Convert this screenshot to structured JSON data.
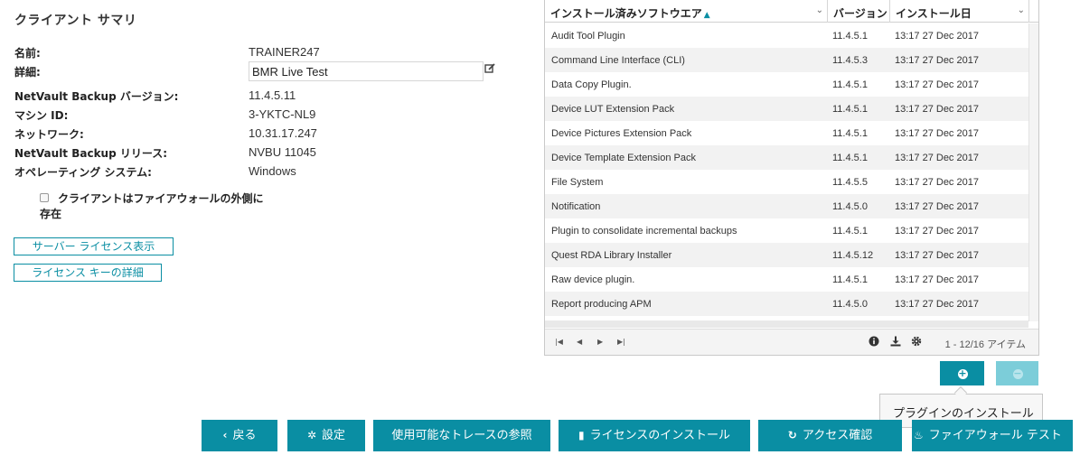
{
  "summary": {
    "title": "クライアント サマリ",
    "fields": [
      {
        "label": "名前:",
        "value": "TRAINER247"
      },
      {
        "label": "詳細:",
        "value": "BMR Live Test"
      },
      {
        "label": "NetVault Backup バージョン:",
        "value": "11.4.5.11"
      },
      {
        "label": "マシン ID:",
        "value": "3-YKTC-NL9"
      },
      {
        "label": "ネットワーク:",
        "value": "10.31.17.247"
      },
      {
        "label": "NetVault Backup リリース:",
        "value": "NVBU 11045"
      },
      {
        "label": "オペレーティング システム:",
        "value": "Windows"
      }
    ],
    "firewall_label": "クライアントはファイアウォールの外側に存在",
    "firewall_checked": false,
    "buttons": {
      "server_license": "サーバー ライセンス表示",
      "license_key": "ライセンス キーの詳細"
    }
  },
  "software_grid": {
    "columns": [
      "インストール済みソフトウエア",
      "バージョン",
      "インストール日"
    ],
    "sort_column": "インストール済みソフトウエア",
    "sort_direction": "ascending",
    "rows": [
      {
        "name": "Audit Tool Plugin",
        "version": "11.4.5.1",
        "date": "13:17 27 Dec 2017"
      },
      {
        "name": "Command Line Interface (CLI)",
        "version": "11.4.5.3",
        "date": "13:17 27 Dec 2017"
      },
      {
        "name": "Data Copy Plugin.",
        "version": "11.4.5.1",
        "date": "13:17 27 Dec 2017"
      },
      {
        "name": "Device LUT Extension Pack",
        "version": "11.4.5.1",
        "date": "13:17 27 Dec 2017"
      },
      {
        "name": "Device Pictures Extension Pack",
        "version": "11.4.5.1",
        "date": "13:17 27 Dec 2017"
      },
      {
        "name": "Device Template Extension Pack",
        "version": "11.4.5.1",
        "date": "13:17 27 Dec 2017"
      },
      {
        "name": "File System",
        "version": "11.4.5.5",
        "date": "13:17 27 Dec 2017"
      },
      {
        "name": "Notification",
        "version": "11.4.5.0",
        "date": "13:17 27 Dec 2017"
      },
      {
        "name": "Plugin to consolidate incremental backups",
        "version": "11.4.5.1",
        "date": "13:17 27 Dec 2017"
      },
      {
        "name": "Quest RDA Library Installer",
        "version": "11.4.5.12",
        "date": "13:17 27 Dec 2017"
      },
      {
        "name": "Raw device plugin.",
        "version": "11.4.5.1",
        "date": "13:17 27 Dec 2017"
      },
      {
        "name": "Report producing APM",
        "version": "11.4.5.0",
        "date": "13:17 27 Dec 2017"
      }
    ],
    "item_count": "1 - 12/16 アイテム",
    "pager_icons": [
      "first-page-icon",
      "prev-page-icon",
      "next-page-icon",
      "last-page-icon"
    ],
    "footer_icons": [
      "info-icon",
      "download-icon",
      "gear-icon"
    ]
  },
  "plugin_actions": {
    "add_icon": "plus-circle-icon",
    "remove_icon": "minus-circle-icon",
    "remove_disabled": true,
    "tooltip": "プラグインのインストール"
  },
  "bottom_buttons": [
    {
      "icon": "chevron-left-icon",
      "label": "戻る"
    },
    {
      "icon": "gear-icon",
      "label": "設定"
    },
    {
      "icon": "",
      "label": "使用可能なトレースの参照"
    },
    {
      "icon": "file-icon",
      "label": "ライセンスのインストール"
    },
    {
      "icon": "refresh-icon",
      "label": "アクセス確認"
    },
    {
      "icon": "flame-icon",
      "label": "ファイアウォール テスト"
    }
  ],
  "colors": {
    "accent": "#0a8ea3",
    "accent_disabled": "#7ccdd9",
    "row_alt": "#f2f2f2",
    "tooltip_bg": "#f7f7f7"
  }
}
